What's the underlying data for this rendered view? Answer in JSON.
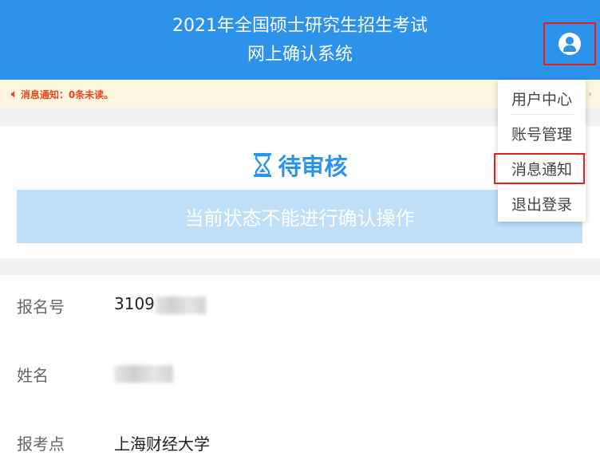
{
  "header": {
    "title_line1": "2021年全国硕士研究生招生考试",
    "title_line2": "网上确认系统",
    "user_icon": "user-circle-icon"
  },
  "notice": {
    "icon": "speaker-icon",
    "text": "消息通知：0条未读。"
  },
  "status": {
    "title": "待审核",
    "icon": "hourglass-icon",
    "bar_text": "当前状态不能进行确认操作"
  },
  "info": {
    "rows": [
      {
        "label": "报名号",
        "value": "3109"
      },
      {
        "label": "姓名",
        "value": ""
      },
      {
        "label": "报考点",
        "value": "上海财经大学"
      }
    ]
  },
  "menu": {
    "items": [
      {
        "label": "用户中心"
      },
      {
        "label": "账号管理"
      },
      {
        "label": "消息通知"
      },
      {
        "label": "退出登录"
      }
    ]
  },
  "colors": {
    "header_bg": "#2c92ea",
    "notice_bg": "#fdf6de",
    "notice_text": "#e8461f",
    "status_bar_bg": "#bfe0f8",
    "highlight_border": "#e0211f"
  }
}
